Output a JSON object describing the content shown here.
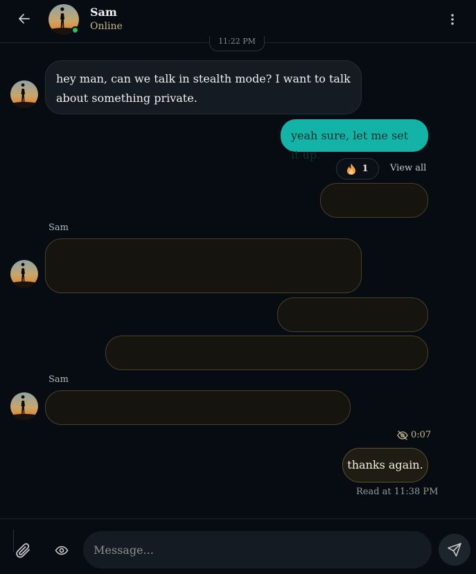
{
  "header": {
    "contact_name": "Sam",
    "status": "Online",
    "back_icon": "arrow-left-icon",
    "menu_icon": "more-vertical-icon"
  },
  "time_divider": "11:22 PM",
  "messages": [
    {
      "sender": "Sam",
      "direction": "incoming",
      "text": "hey man, can we talk in stealth mode? I want to talk about something private."
    },
    {
      "sender": "me",
      "direction": "outgoing",
      "text": "yeah sure, let me set it up.",
      "reaction": {
        "icon": "fire-icon",
        "count": "1"
      },
      "view_all_label": "View all"
    },
    {
      "sender": "me",
      "direction": "outgoing",
      "stealth": true
    },
    {
      "sender": "Sam",
      "direction": "incoming",
      "stealth": true,
      "sender_label": "Sam"
    },
    {
      "sender": "me",
      "direction": "outgoing",
      "stealth": true
    },
    {
      "sender": "me",
      "direction": "outgoing",
      "stealth": true
    },
    {
      "sender": "Sam",
      "direction": "incoming",
      "stealth": true,
      "sender_label": "Sam"
    },
    {
      "sender": "me",
      "direction": "outgoing",
      "text": "thanks again.",
      "timer": "0:07",
      "timer_icon": "eye-off-icon",
      "read_receipt": "Read at 11:38 PM"
    }
  ],
  "composer": {
    "placeholder": "Message...",
    "attach_icon": "paperclip-icon",
    "stealth_icon": "eye-icon",
    "send_icon": "send-icon"
  },
  "colors": {
    "background": "#060c12",
    "outgoing_bubble": "#14b3a8",
    "incoming_bubble": "#151b22",
    "stealth_border": "#4a4225",
    "online": "#22c55e"
  }
}
